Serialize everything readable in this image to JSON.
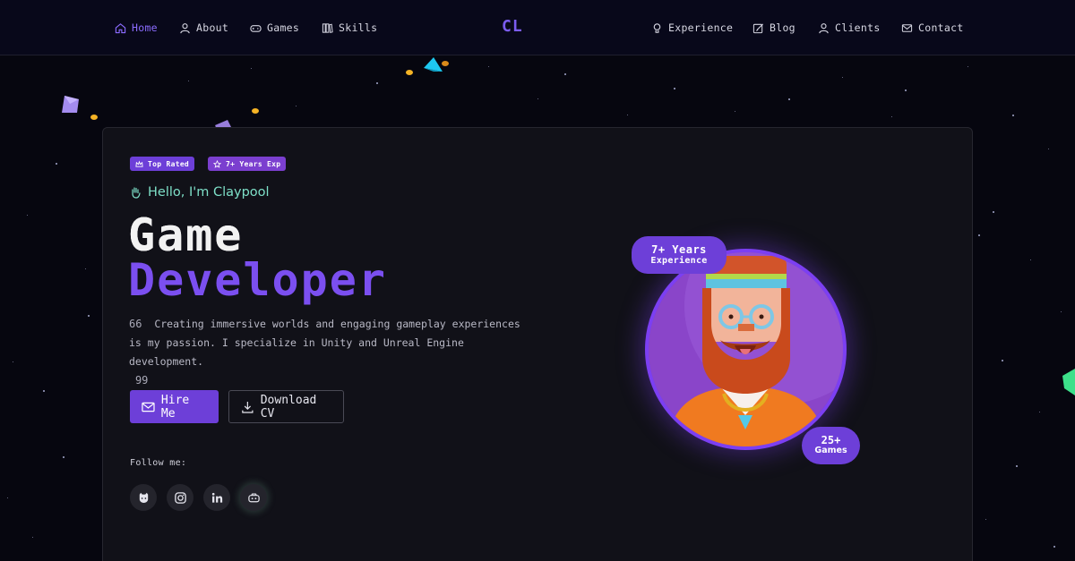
{
  "nav": {
    "logo": "CL",
    "left": [
      {
        "label": "Home",
        "icon": "home-icon",
        "active": true
      },
      {
        "label": "About",
        "icon": "user-icon"
      },
      {
        "label": "Games",
        "icon": "gamepad-icon"
      },
      {
        "label": "Skills",
        "icon": "books-icon"
      }
    ],
    "right": [
      {
        "label": "Experience",
        "icon": "lightbulb-icon"
      },
      {
        "label": "Blog",
        "icon": "edit-icon"
      },
      {
        "label": "Clients",
        "icon": "user-icon"
      },
      {
        "label": "Contact",
        "icon": "mail-icon"
      }
    ]
  },
  "hero": {
    "badges": [
      {
        "label": "Top Rated",
        "icon": "crown-icon"
      },
      {
        "label": "7+ Years Exp",
        "icon": "star-icon"
      }
    ],
    "greeting": "Hello, I'm Claypool",
    "title_line1": "Game",
    "title_line2": "Developer",
    "quote_open": "66",
    "quote_text": "Creating immersive worlds and engaging gameplay experiences is my passion. I specialize in Unity and Unreal Engine development.",
    "quote_close": "99",
    "hire_label": "Hire Me",
    "cv_label": "Download CV",
    "follow_label": "Follow me:",
    "socials": [
      "github-icon",
      "instagram-icon",
      "linkedin-icon",
      "discord-icon"
    ]
  },
  "avatar": {
    "exp_big": "7+ Years",
    "exp_small": "Experience",
    "games_big": "25+",
    "games_small": "Games"
  },
  "colors": {
    "accent": "#6d3fd8",
    "accent_text": "#7b4ff0",
    "greeting": "#7ee0c8",
    "background": "#06060f",
    "card": "#111118"
  }
}
